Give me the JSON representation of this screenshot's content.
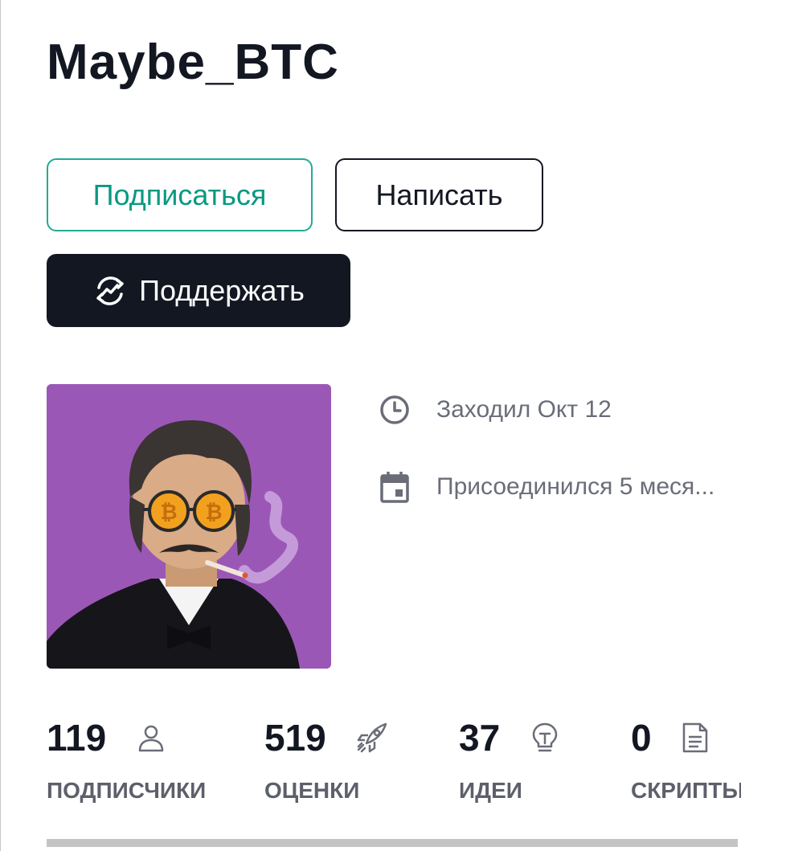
{
  "profile": {
    "username": "Maybe_BTC"
  },
  "actions": {
    "follow_label": "Подписаться",
    "message_label": "Написать",
    "support_label": "Поддержать"
  },
  "meta": {
    "last_seen": "Заходил Окт 12",
    "joined": "Присоединился 5 меся..."
  },
  "stats": [
    {
      "value": "119",
      "label": "ПОДПИСЧИКИ",
      "icon": "person-icon"
    },
    {
      "value": "519",
      "label": "ОЦЕНКИ",
      "icon": "rocket-icon"
    },
    {
      "value": "37",
      "label": "ИДЕИ",
      "icon": "lightbulb-icon"
    },
    {
      "value": "0",
      "label": "СКРИПТЫ",
      "icon": "script-icon"
    }
  ],
  "colors": {
    "accent": "#22ab94",
    "dark": "#131722",
    "muted": "#6a6d78",
    "avatar_bg": "#9b57b6"
  }
}
